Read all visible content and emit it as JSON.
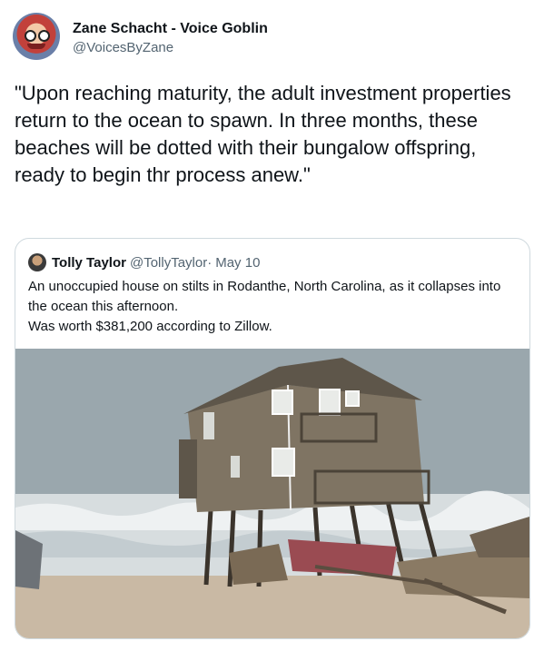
{
  "author": {
    "display_name": "Zane Schacht - Voice Goblin",
    "handle": "@VoicesByZane",
    "avatar_icon": "cartoon-avatar-icon"
  },
  "tweet": {
    "text": "\"Upon reaching maturity, the adult investment properties return to the ocean to spawn. In three months, these beaches will be dotted with their bungalow offspring, ready to begin thr process anew.\""
  },
  "quoted_tweet": {
    "display_name": "Tolly Taylor",
    "handle": "@TollyTaylor",
    "separator": "·",
    "date": "May 10",
    "text": "An unoccupied house on stilts in Rodanthe, North Carolina, as it collapses into the ocean this afternoon.\nWas worth $381,200 according to Zillow.",
    "media": {
      "description_icon": "collapsing-beach-house-photo",
      "colors": {
        "sky": "#9aa7ad",
        "sea": "#d9dfe0",
        "house": "#7f7463",
        "sand": "#c9b9a4"
      }
    }
  }
}
